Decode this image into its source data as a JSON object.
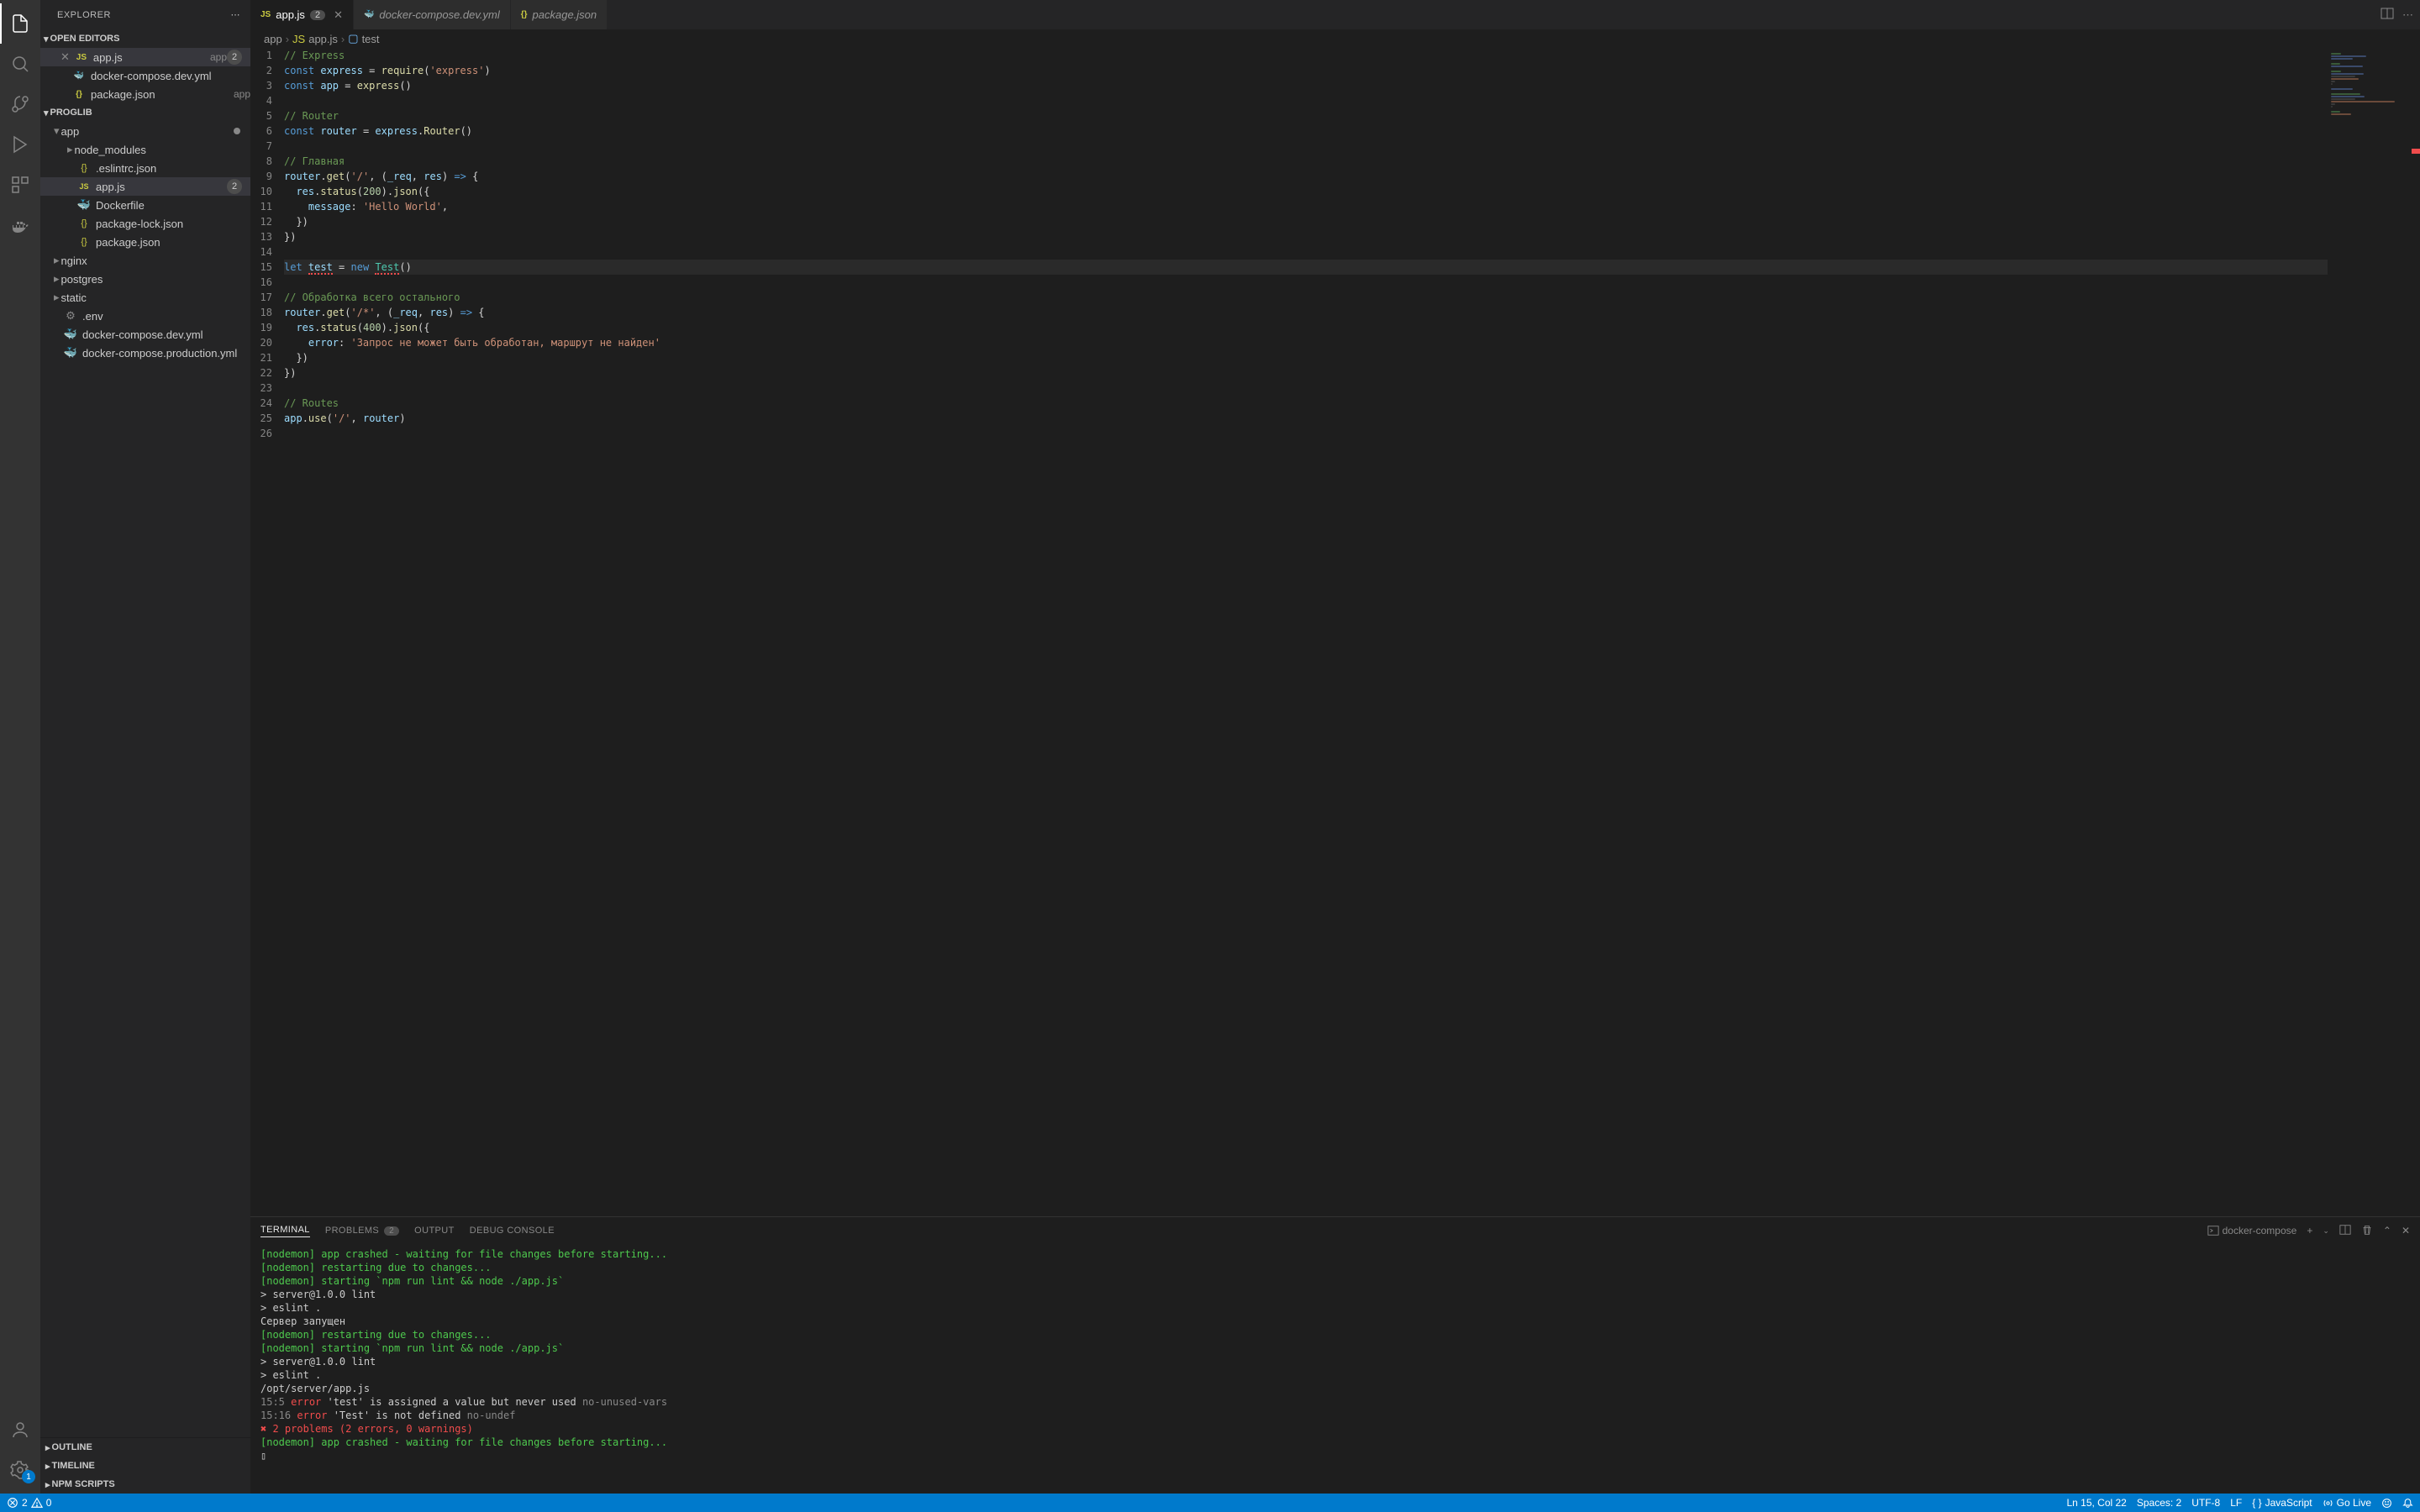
{
  "sidebar": {
    "title": "EXPLORER",
    "sections": {
      "open_editors": "OPEN EDITORS",
      "proglib": "PROGLIB",
      "outline": "OUTLINE",
      "timeline": "TIMELINE",
      "npm_scripts": "NPM SCRIPTS"
    },
    "open_editors_items": [
      {
        "name": "app.js",
        "desc": "app",
        "count": "2",
        "active": true
      },
      {
        "name": "docker-compose.dev.yml",
        "desc": ""
      },
      {
        "name": "package.json",
        "desc": "app"
      }
    ],
    "tree": [
      {
        "name": "app",
        "type": "folder",
        "indent": 0,
        "expanded": true,
        "modified": true
      },
      {
        "name": "node_modules",
        "type": "folder",
        "indent": 1
      },
      {
        "name": ".eslintrc.json",
        "type": "json",
        "indent": 1
      },
      {
        "name": "app.js",
        "type": "js",
        "indent": 1,
        "count": "2",
        "selected": true
      },
      {
        "name": "Dockerfile",
        "type": "docker",
        "indent": 1
      },
      {
        "name": "package-lock.json",
        "type": "json",
        "indent": 1
      },
      {
        "name": "package.json",
        "type": "json",
        "indent": 1
      },
      {
        "name": "nginx",
        "type": "folder",
        "indent": 0
      },
      {
        "name": "postgres",
        "type": "folder",
        "indent": 0
      },
      {
        "name": "static",
        "type": "folder",
        "indent": 0
      },
      {
        "name": ".env",
        "type": "gear",
        "indent": 0
      },
      {
        "name": "docker-compose.dev.yml",
        "type": "docker-pink",
        "indent": 0
      },
      {
        "name": "docker-compose.production.yml",
        "type": "docker-pink",
        "indent": 0
      }
    ]
  },
  "tabs": [
    {
      "label": "app.js",
      "type": "js",
      "count": "2",
      "active": true,
      "close": true
    },
    {
      "label": "docker-compose.dev.yml",
      "type": "docker-pink",
      "italic": true
    },
    {
      "label": "package.json",
      "type": "json",
      "italic": true
    }
  ],
  "breadcrumb": [
    "app",
    "app.js",
    "test"
  ],
  "code_lines": [
    {
      "n": 1,
      "html": "<span class='cmt'>// Express</span>"
    },
    {
      "n": 2,
      "html": "<span class='kw'>const</span> <span class='var'>express</span> = <span class='fn'>require</span>(<span class='str'>'express'</span>)"
    },
    {
      "n": 3,
      "html": "<span class='kw'>const</span> <span class='var'>app</span> = <span class='fn'>express</span>()"
    },
    {
      "n": 4,
      "html": ""
    },
    {
      "n": 5,
      "html": "<span class='cmt'>// Router</span>"
    },
    {
      "n": 6,
      "html": "<span class='kw'>const</span> <span class='var'>router</span> = <span class='var'>express</span>.<span class='fn'>Router</span>()"
    },
    {
      "n": 7,
      "html": ""
    },
    {
      "n": 8,
      "html": "<span class='cmt'>// Главная</span>"
    },
    {
      "n": 9,
      "html": "<span class='var'>router</span>.<span class='fn'>get</span>(<span class='str'>'/'</span>, (<span class='var'>_req</span>, <span class='var'>res</span>) <span class='kw'>=></span> {"
    },
    {
      "n": 10,
      "html": "  <span class='var'>res</span>.<span class='fn'>status</span>(<span class='num'>200</span>).<span class='fn'>json</span>({"
    },
    {
      "n": 11,
      "html": "    <span class='prop'>message</span>: <span class='str'>'Hello World'</span>,"
    },
    {
      "n": 12,
      "html": "  })"
    },
    {
      "n": 13,
      "html": "})"
    },
    {
      "n": 14,
      "html": ""
    },
    {
      "n": 15,
      "html": "<span class='kw'>let</span> <span class='var err-underline'>test</span> = <span class='kw'>new</span> <span class='cls err-underline'>Test</span>()",
      "current": true
    },
    {
      "n": 16,
      "html": ""
    },
    {
      "n": 17,
      "html": "<span class='cmt'>// Обработка всего остального</span>"
    },
    {
      "n": 18,
      "html": "<span class='var'>router</span>.<span class='fn'>get</span>(<span class='str'>'/*'</span>, (<span class='var'>_req</span>, <span class='var'>res</span>) <span class='kw'>=></span> {"
    },
    {
      "n": 19,
      "html": "  <span class='var'>res</span>.<span class='fn'>status</span>(<span class='num'>400</span>).<span class='fn'>json</span>({"
    },
    {
      "n": 20,
      "html": "    <span class='prop'>error</span>: <span class='str'>'Запрос не может быть обработан, маршрут не найден'</span>"
    },
    {
      "n": 21,
      "html": "  })"
    },
    {
      "n": 22,
      "html": "})"
    },
    {
      "n": 23,
      "html": ""
    },
    {
      "n": 24,
      "html": "<span class='cmt'>// Routes</span>"
    },
    {
      "n": 25,
      "html": "<span class='var'>app</span>.<span class='fn'>use</span>(<span class='str'>'/'</span>, <span class='var'>router</span>)"
    },
    {
      "n": 26,
      "html": ""
    }
  ],
  "panel": {
    "tabs": {
      "terminal": "TERMINAL",
      "problems": "PROBLEMS",
      "problems_count": "2",
      "output": "OUTPUT",
      "debug": "DEBUG CONSOLE"
    },
    "terminal_name": "docker-compose",
    "terminal_lines": [
      {
        "cls": "t-green",
        "text": "[nodemon] app crashed - waiting for file changes before starting..."
      },
      {
        "cls": "t-green",
        "text": "[nodemon] restarting due to changes..."
      },
      {
        "cls": "t-green",
        "text": "[nodemon] starting `npm run lint && node ./app.js`"
      },
      {
        "cls": "",
        "text": " "
      },
      {
        "cls": "t-white",
        "text": "> server@1.0.0 lint"
      },
      {
        "cls": "t-white",
        "text": "> eslint ."
      },
      {
        "cls": "",
        "text": " "
      },
      {
        "cls": "t-white",
        "text": "Сервер запущен"
      },
      {
        "cls": "t-green",
        "text": "[nodemon] restarting due to changes..."
      },
      {
        "cls": "t-green",
        "text": "[nodemon] starting `npm run lint && node ./app.js`"
      },
      {
        "cls": "",
        "text": " "
      },
      {
        "cls": "t-white",
        "text": "> server@1.0.0 lint"
      },
      {
        "cls": "t-white",
        "text": "> eslint ."
      },
      {
        "cls": "",
        "text": " "
      },
      {
        "cls": "",
        "text": " "
      },
      {
        "cls": "t-white",
        "text": "/opt/server/app.js"
      },
      {
        "cls": "",
        "html": "  <span class='t-dim'>15:5</span>   <span class='t-red'>error</span>  'test' is assigned a value but never used  <span class='t-dim'>no-unused-vars</span>"
      },
      {
        "cls": "",
        "html": "  <span class='t-dim'>15:16</span>  <span class='t-red'>error</span>  'Test' is not defined                      <span class='t-dim'>no-undef</span>"
      },
      {
        "cls": "",
        "text": " "
      },
      {
        "cls": "t-red",
        "text": "✖ 2 problems (2 errors, 0 warnings)"
      },
      {
        "cls": "",
        "text": " "
      },
      {
        "cls": "t-green",
        "text": "[nodemon] app crashed - waiting for file changes before starting..."
      },
      {
        "cls": "t-white",
        "text": "▯"
      }
    ]
  },
  "status": {
    "errors": "2",
    "warnings": "0",
    "ln_col": "Ln 15, Col 22",
    "spaces": "Spaces: 2",
    "encoding": "UTF-8",
    "eol": "LF",
    "lang": "JavaScript",
    "go_live": "Go Live"
  },
  "activity_badge": "1"
}
